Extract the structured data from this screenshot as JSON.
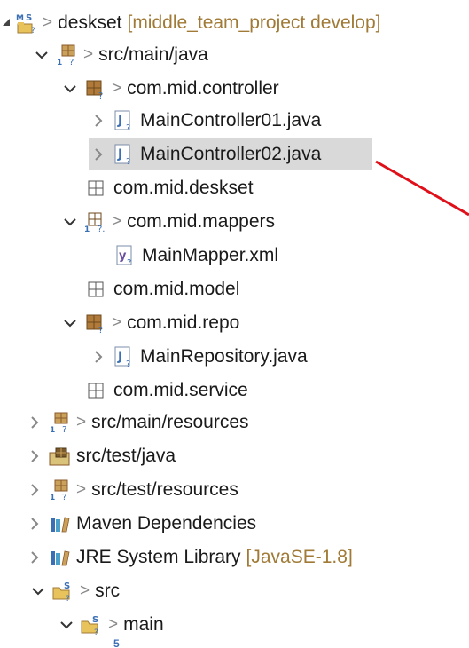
{
  "tree": {
    "project": {
      "label": "deskset",
      "decoration": "[middle_team_project develop]",
      "project_badge": "M S"
    },
    "src_main_java": "src/main/java",
    "pkg_controller": "com.mid.controller",
    "file_controller01": "MainController01.java",
    "file_controller02": "MainController02.java",
    "pkg_deskset": "com.mid.deskset",
    "pkg_mappers": "com.mid.mappers",
    "file_mapper_xml": "MainMapper.xml",
    "pkg_model": "com.mid.model",
    "pkg_repo": "com.mid.repo",
    "file_repository": "MainRepository.java",
    "pkg_service": "com.mid.service",
    "src_main_resources": "src/main/resources",
    "src_test_java": "src/test/java",
    "src_test_resources": "src/test/resources",
    "maven_deps": "Maven Dependencies",
    "jre_label": "JRE System Library",
    "jre_version": "[JavaSE-1.8]",
    "folder_src": "src",
    "folder_main": "main"
  },
  "markers": {
    "git_prefix": ">",
    "incoming_flag": "?"
  },
  "colors": {
    "selection": "#d9d9d9",
    "annotation_arrow": "#e0101a",
    "package": "#8b5a2b",
    "java_file": "#3b6fb5",
    "decoration": "#a07a36"
  }
}
